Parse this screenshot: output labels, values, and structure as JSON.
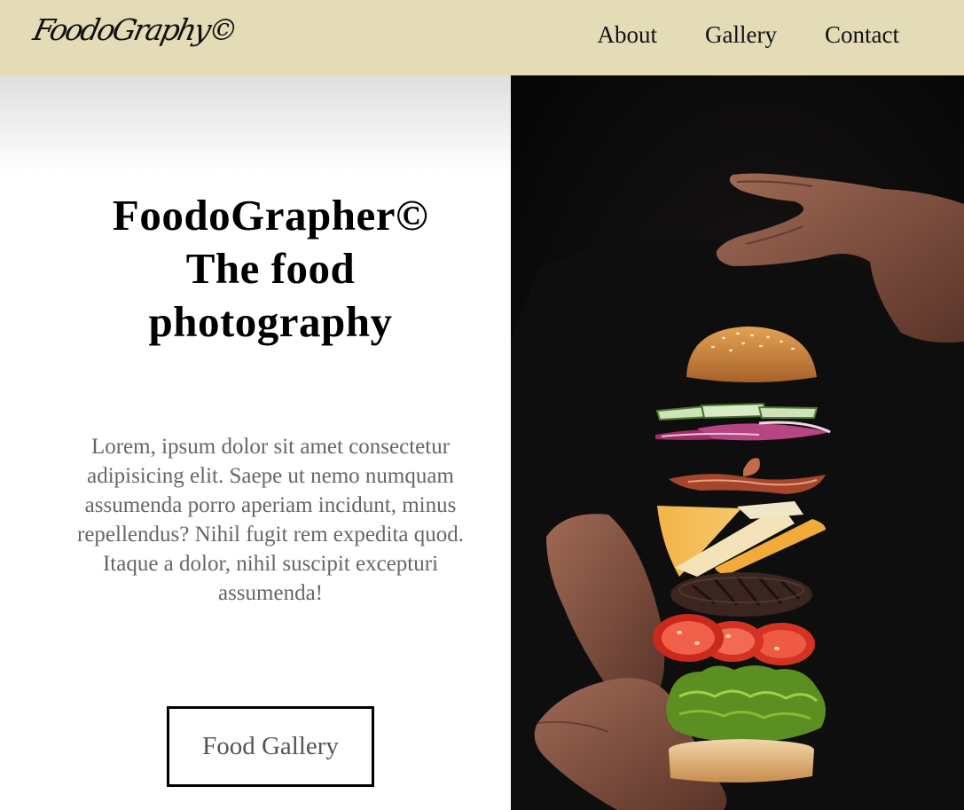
{
  "brand": {
    "logo_text": "FoodoGraphy©"
  },
  "nav": {
    "items": [
      "About",
      "Gallery",
      "Contact"
    ]
  },
  "hero_text": {
    "title_lines": [
      "FoodoGrapher©",
      "The food",
      "photography"
    ],
    "body": "Lorem, ipsum dolor sit amet consectetur adipisicing elit. Saepe ut nemo numquam assumenda porro aperiam incidunt, minus repellendus? Nihil fugit rem expedita quod. Itaque a dolor, nihil suscipit excepturi assumenda!",
    "cta_label": "Food Gallery"
  },
  "colors": {
    "header_bg": "#e4dbb7",
    "photo_bg": "#0c0b0b",
    "body_text": "#666666"
  },
  "image": {
    "subject": "floating-burger-photo"
  }
}
